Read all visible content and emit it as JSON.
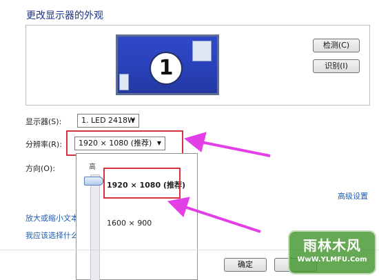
{
  "header": {
    "title": "更改显示器的外观"
  },
  "preview": {
    "monitor_number": "1"
  },
  "buttons": {
    "detect": "检测(C)",
    "identify": "识别(I)",
    "ok": "确定"
  },
  "form": {
    "display_label": "显示器(S):",
    "display_value": "1. LED 2418W",
    "resolution_label": "分辨率(R):",
    "resolution_value": "1920 × 1080 (推荐)",
    "orientation_label": "方向(O):"
  },
  "dropdown": {
    "high_label": "高",
    "option_recommended": "1920 × 1080 (推荐)",
    "option_2": "1600 × 900"
  },
  "links": {
    "advanced": "高级设置",
    "scale_text": "放大或缩小文本",
    "choose_text": "我应该选择什么"
  },
  "watermark": {
    "main": "雨林木风",
    "sub": "WwW.YLMFU.Com"
  },
  "colors": {
    "highlight": "#d6323b",
    "annotation_arrow": "#e23fe6",
    "monitor_fill": "#2f49c8",
    "link": "#1d5fb5"
  }
}
